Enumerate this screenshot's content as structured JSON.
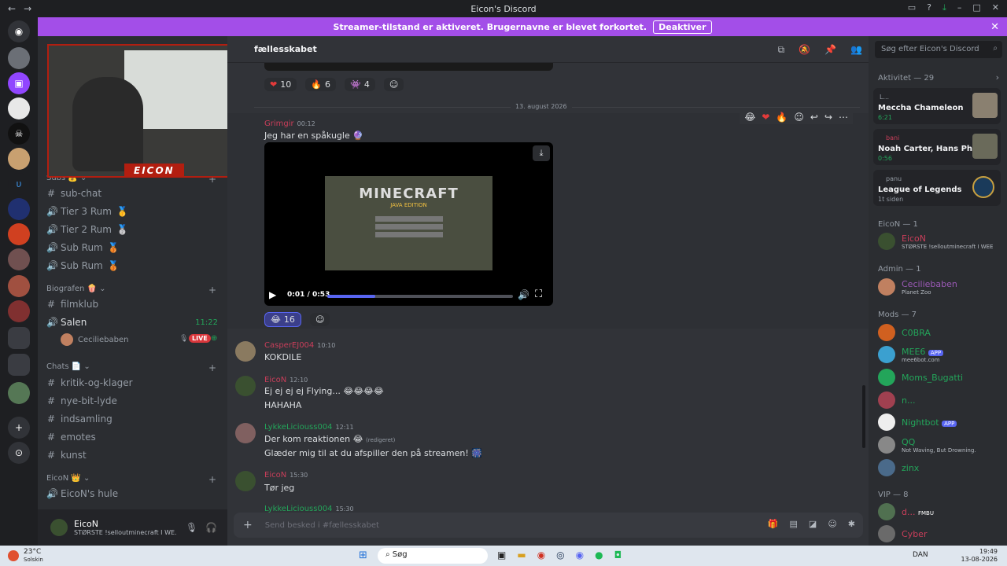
{
  "window": {
    "title": "Eicon's Discord"
  },
  "banner": {
    "text": "Streamer-tilstand er aktiveret. Brugernavne er blevet forkortet.",
    "button": "Deaktiver"
  },
  "channel_header": {
    "name": "fællesskabet",
    "search_placeholder": "Søg efter Eicon's Discord"
  },
  "channels": {
    "sub_cat": "Subs",
    "items": [
      {
        "name": "sub-chat",
        "type": "text"
      },
      {
        "name": "Tier 3 Rum",
        "type": "voice"
      },
      {
        "name": "Tier 2 Rum",
        "type": "voice"
      },
      {
        "name": "Sub Rum",
        "type": "voice"
      },
      {
        "name": "Sub Rum",
        "type": "voice"
      }
    ],
    "biograf_cat": "Biografen",
    "biograf_items": [
      {
        "name": "filmklub",
        "type": "text"
      },
      {
        "name": "Salen",
        "type": "voice",
        "time": "11:22"
      }
    ],
    "voice_user": {
      "name": "Ceciliebaben",
      "badge": "LIVE"
    },
    "chats_cat": "Chats",
    "chats_items": [
      {
        "name": "kritik-og-klager"
      },
      {
        "name": "nye-bit-lyde"
      },
      {
        "name": "indsamling"
      },
      {
        "name": "emotes"
      },
      {
        "name": "kunst"
      }
    ],
    "eicon_cat": "EicoN",
    "eicon_items": [
      {
        "name": "EicoN's hule"
      }
    ]
  },
  "webcam": {
    "label": "EICON"
  },
  "user": {
    "name": "EicoN",
    "status": "STØRSTE !selloutminecraft I WE..."
  },
  "chat": {
    "top_reactions": [
      {
        "emoji": "❤",
        "count": "10"
      },
      {
        "emoji": "🔥",
        "count": "6"
      },
      {
        "emoji": "👾",
        "count": "4"
      }
    ],
    "date_divider": "13. august 2026",
    "messages": [
      {
        "author": "Grimgir",
        "time": "00:12",
        "text": "Jeg har en spåkugle 🔮",
        "author_color": "#c93e5a"
      },
      {
        "author": "CasperEJ004",
        "time": "10:10",
        "text": "KOKDILE",
        "author_color": "#c93e5a"
      },
      {
        "author": "EicoN",
        "time": "12:10",
        "text": "Ej ej ej ej Flying... 😂😂😂😂",
        "text2": "HAHAHA",
        "author_color": "#c93e5a"
      },
      {
        "author": "LykkeLiciouss004",
        "time": "12:11",
        "text": "Der kom reaktionen 😂",
        "edited": "(redigeret)",
        "text2": "Glæder mig til at du afspiller den på streamen! 🎆",
        "author_color": "#23a55a"
      },
      {
        "author": "EicoN",
        "time": "15:30",
        "text": "Tør jeg",
        "author_color": "#c93e5a"
      },
      {
        "author": "LykkeLiciouss004",
        "time": "15:30",
        "author_color": "#23a55a"
      }
    ],
    "video": {
      "title": "MINECRAFT",
      "subtitle": "JAVA EDITION",
      "time": "0:01 / 0:53",
      "progress": 0.26
    },
    "video_reaction": {
      "emoji": "😂",
      "count": "16"
    },
    "input_placeholder": "Send besked i #fællesskabet"
  },
  "members": {
    "activity_header": "Aktivitet — 29",
    "activities": [
      {
        "user": "L...",
        "title": "Meccha Chameleon",
        "meta": "6:21"
      },
      {
        "user": "bani",
        "title": "Noah Carter, Hans Philip",
        "meta": "0:56"
      },
      {
        "user": "panu",
        "title": "League of Legends",
        "meta": "1t siden"
      }
    ],
    "sections": [
      {
        "header": "EicoN — 1",
        "items": [
          {
            "name": "EicoN",
            "sub": "STØRSTE !selloutminecraft I WEE",
            "color": "#c93e5a"
          }
        ]
      },
      {
        "header": "Admin — 1",
        "items": [
          {
            "name": "Ceciliebaben",
            "sub": "Planet Zoo",
            "color": "#9b59b6"
          }
        ]
      },
      {
        "header": "Mods — 7",
        "items": [
          {
            "name": "C0BRA",
            "color": "#23a55a"
          },
          {
            "name": "MEE6",
            "sub": "mee6bot.com",
            "color": "#23a55a",
            "tag": "APP"
          },
          {
            "name": "Moms_Bugatti",
            "color": "#23a55a"
          },
          {
            "name": "n...",
            "color": "#23a55a"
          },
          {
            "name": "Nightbot",
            "color": "#23a55a",
            "tag": "APP"
          },
          {
            "name": "QQ",
            "sub": "Not Waving, But Drowning.",
            "color": "#23a55a"
          },
          {
            "name": "zinx",
            "color": "#23a55a"
          }
        ]
      },
      {
        "header": "VIP — 8",
        "items": [
          {
            "name": "d...",
            "color": "#c93e5a",
            "tag": "FMBU"
          },
          {
            "name": "Cyber",
            "color": "#c93e5a"
          }
        ]
      }
    ]
  },
  "taskbar": {
    "weather": "23°C",
    "weather_sub": "Solskin",
    "search": "Søg",
    "lang": "DAN",
    "time": "19:49",
    "date": "13-08-2026"
  },
  "colors": {
    "banner": "#a34ee8",
    "accent": "#5865f2",
    "live": "#da373c"
  }
}
